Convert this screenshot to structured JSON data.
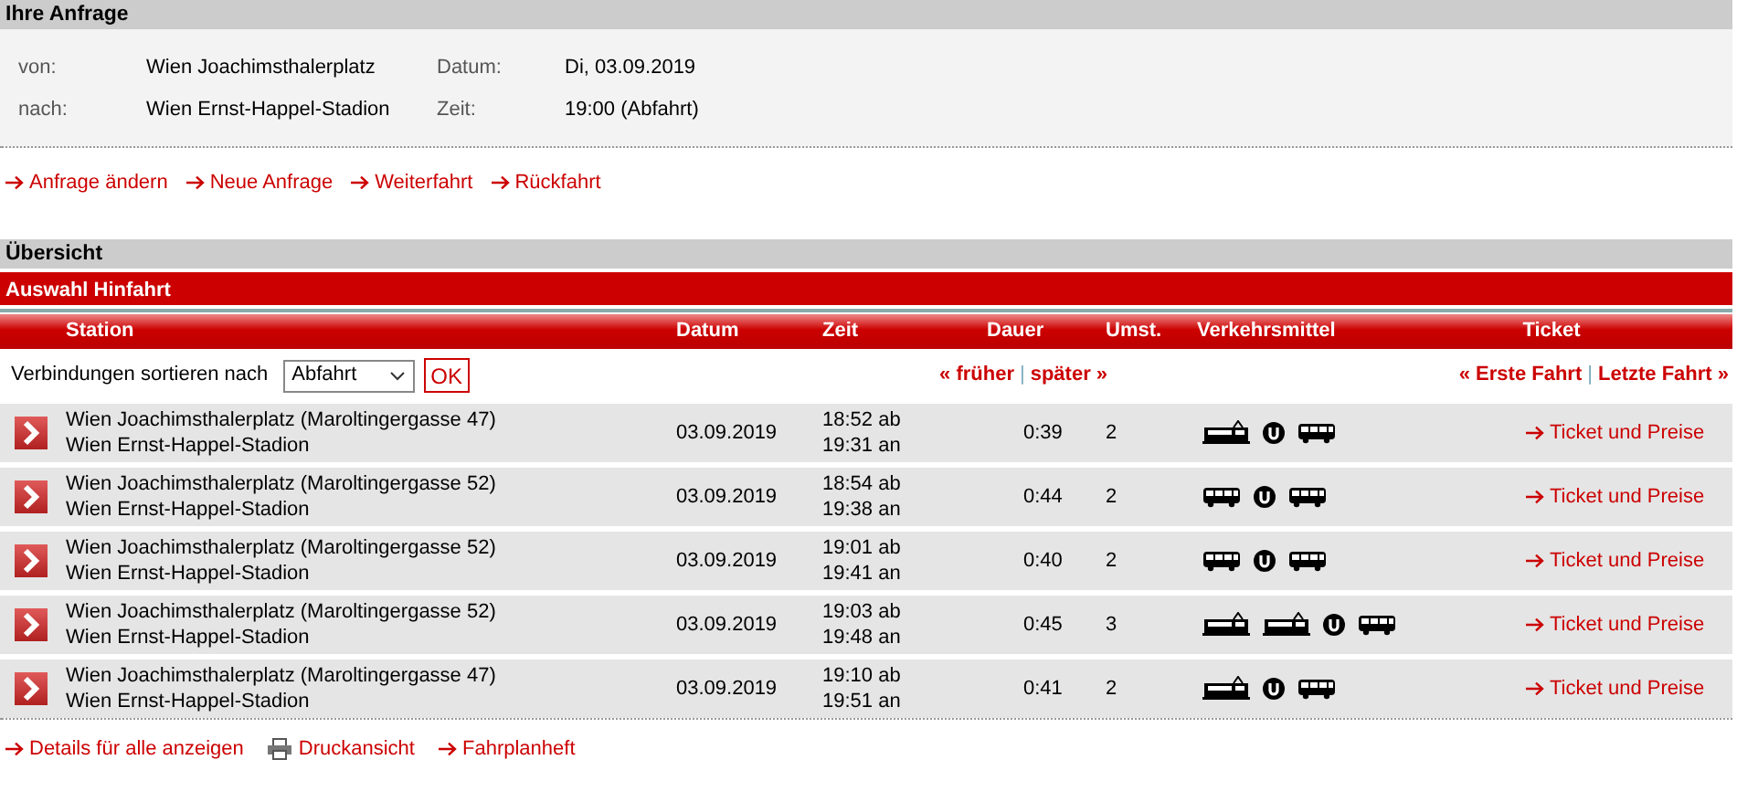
{
  "request": {
    "title": "Ihre Anfrage",
    "fields": [
      {
        "label": "von:",
        "value": "Wien Joachimsthalerplatz",
        "label2": "Datum:",
        "value2": "Di, 03.09.2019"
      },
      {
        "label": "nach:",
        "value": "Wien Ernst-Happel-Stadion",
        "label2": "Zeit:",
        "value2": "19:00 (Abfahrt)"
      }
    ],
    "links": [
      "Anfrage ändern",
      "Neue Anfrage",
      "Weiterfahrt",
      "Rückfahrt"
    ]
  },
  "overview": {
    "title": "Übersicht",
    "subtitle": "Auswahl Hinfahrt",
    "columns": [
      "Station",
      "Datum",
      "Zeit",
      "Dauer",
      "Umst.",
      "Verkehrsmittel",
      "Ticket"
    ],
    "sort": {
      "label": "Verbindungen sortieren nach",
      "value": "Abfahrt",
      "button": "OK"
    },
    "pager": {
      "earlier": "« früher",
      "separator": "|",
      "later": "später »",
      "first": "« Erste Fahrt",
      "separator2": "|",
      "last": "Letzte Fahrt »"
    },
    "rows": [
      {
        "from": "Wien Joachimsthalerplatz (Maroltingergasse 47)",
        "to": "Wien Ernst-Happel-Stadion",
        "date": "03.09.2019",
        "departure": "18:52 ab",
        "arrival": "19:31 an",
        "duration": "0:39",
        "changes": "2",
        "transport": [
          {
            "kind": "tram"
          },
          {
            "kind": "subway"
          },
          {
            "kind": "bus"
          }
        ],
        "ticket": "Ticket und Preise"
      },
      {
        "from": "Wien Joachimsthalerplatz (Maroltingergasse 52)",
        "to": "Wien Ernst-Happel-Stadion",
        "date": "03.09.2019",
        "departure": "18:54 ab",
        "arrival": "19:38 an",
        "duration": "0:44",
        "changes": "2",
        "transport": [
          {
            "kind": "bus"
          },
          {
            "kind": "subway"
          },
          {
            "kind": "bus"
          }
        ],
        "ticket": "Ticket und Preise"
      },
      {
        "from": "Wien Joachimsthalerplatz (Maroltingergasse 52)",
        "to": "Wien Ernst-Happel-Stadion",
        "date": "03.09.2019",
        "departure": "19:01 ab",
        "arrival": "19:41 an",
        "duration": "0:40",
        "changes": "2",
        "transport": [
          {
            "kind": "bus"
          },
          {
            "kind": "subway"
          },
          {
            "kind": "bus"
          }
        ],
        "ticket": "Ticket und Preise"
      },
      {
        "from": "Wien Joachimsthalerplatz (Maroltingergasse 52)",
        "to": "Wien Ernst-Happel-Stadion",
        "date": "03.09.2019",
        "departure": "19:03 ab",
        "arrival": "19:48 an",
        "duration": "0:45",
        "changes": "3",
        "transport": [
          {
            "kind": "tram"
          },
          {
            "kind": "tram"
          },
          {
            "kind": "subway"
          },
          {
            "kind": "bus"
          }
        ],
        "ticket": "Ticket und Preise"
      },
      {
        "from": "Wien Joachimsthalerplatz (Maroltingergasse 47)",
        "to": "Wien Ernst-Happel-Stadion",
        "date": "03.09.2019",
        "departure": "19:10 ab",
        "arrival": "19:51 an",
        "duration": "0:41",
        "changes": "2",
        "transport": [
          {
            "kind": "tram"
          },
          {
            "kind": "subway"
          },
          {
            "kind": "bus"
          }
        ],
        "ticket": "Ticket und Preise"
      }
    ],
    "footer_links": [
      {
        "kind": "arrow",
        "label": "Details für alle anzeigen"
      },
      {
        "kind": "printer",
        "label": "Druckansicht"
      },
      {
        "kind": "arrow",
        "label": "Fahrplanheft"
      }
    ]
  }
}
